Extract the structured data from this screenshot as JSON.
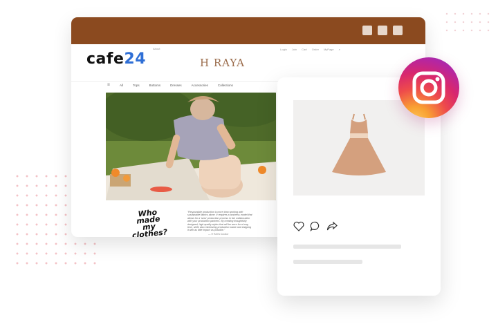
{
  "browser": {
    "window_buttons": [
      "minimize",
      "maximize",
      "close"
    ]
  },
  "store": {
    "brand_logo": "cafe24",
    "brand_logo_accent": "24",
    "shop_logo": "H RAYA",
    "top_links": [
      "Login",
      "Join",
      "Cart",
      "Order",
      "MyPage"
    ],
    "utility_label": "About",
    "menu": [
      "All",
      "Tops",
      "Bottoms",
      "Dresses",
      "Accessories",
      "Collections"
    ],
    "book_logo": "Who made my clothes?",
    "quote": "\"Responsible production is more than working with sustainable fabrics alone. It requires a business model that allows for a 'slow' production process in fair collaboration with your production partners. By creating thoughtfully designed, high quality styles that will be worn for a long time, while also minimizing production waste and shipping it with as little impact as possible.\"",
    "quote_source": "— H RAYA Curator"
  },
  "post": {
    "actions": [
      "heart-icon",
      "comment-icon",
      "share-icon"
    ]
  },
  "colors": {
    "titlebar": "#8b4a1f",
    "dress": "#d4a07e",
    "cafe24_accent": "#2f6fd6"
  }
}
